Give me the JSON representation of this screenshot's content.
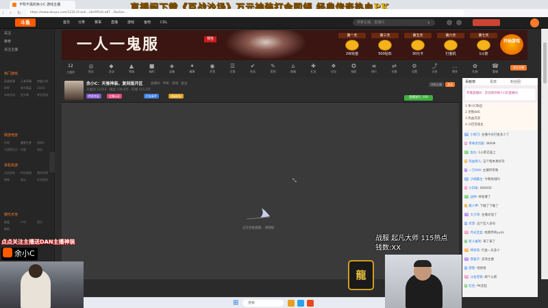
{
  "browser": {
    "tab_title": "不吹不黑的余小C 游戏主播",
    "url": "https://www.douyu.com/12313?rooh...e0c9f5d4-a87...3ba5ac...",
    "nav": "‹ › ↻"
  },
  "stream_banner_text": "直播间下载《百战沙场》万元神装打金即领  经典传奇热血PK",
  "header": {
    "logo": "斗鱼",
    "nav": [
      "首页",
      "分类",
      "赛事",
      "直播",
      "游戏",
      "鱼吧",
      "CDL"
    ],
    "search_placeholder": "搜索主播、直播间"
  },
  "sidebar": {
    "top_items": [
      "关注",
      "推荐",
      "关注主播"
    ],
    "sections": [
      {
        "title": "热门游戏",
        "items": [
          "英雄联盟",
          "王者荣耀",
          "穿越火线",
          "DNF",
          "和平精英",
          "CSGO",
          "永劫无间",
          "逆水寒",
          "梦幻西游"
        ]
      },
      {
        "title": "网游竞技",
        "items": [
          "传奇",
          "魔兽世界",
          "剑网3",
          "天涯明月刀",
          "问道",
          "诛仙"
        ]
      },
      {
        "title": "单机热游",
        "items": [
          "主机游戏",
          "怀旧游戏",
          "我的世界",
          "原神",
          "鬼泣",
          "生化危机"
        ]
      },
      {
        "title": "娱乐天地",
        "items": [
          "颜值",
          "户外",
          "音乐",
          "舞蹈"
        ]
      }
    ]
  },
  "ad": {
    "title": "一人一鬼服",
    "tag": "预告",
    "rewards": [
      {
        "day": "第一天",
        "label": "2W充值"
      },
      {
        "day": "第三天",
        "label": "500钻石"
      },
      {
        "day": "第五天",
        "label": "30元卡"
      },
      {
        "day": "第六天",
        "label": "打金机"
      },
      {
        "day": "第七天",
        "label": "1火箭"
      }
    ],
    "cta": "开始游戏"
  },
  "icon_row": {
    "count": "12",
    "count_label": "主播榜",
    "items": [
      "鱼丸",
      "活动",
      "等级",
      "福利",
      "宝箱",
      "徽章",
      "开黑",
      "日常",
      "任务",
      "签到",
      "商城",
      "礼包",
      "红包",
      "抽奖",
      "排行",
      "兑换",
      "设置",
      "分享",
      "更多",
      "礼物",
      "客服"
    ],
    "follow": "关注主播"
  },
  "streamer": {
    "title": "余小C：天蚕神装，复刻版开区",
    "subtitle": "直播间 · 传奇 · 游戏 · 复古",
    "meta": "斗鱼ID 12313 · 粉丝 236.9万 · 在线 115.2万",
    "chips": [
      "传奇专区",
      "主播认证",
      "打金高手",
      "超级粉丝"
    ],
    "report": "举报主播",
    "follow": "关注",
    "gift": "直播送礼 100"
  },
  "player": {
    "loading": "正在连接直播... 请稍候"
  },
  "chat": {
    "tabs": [
      "贡献榜",
      "贵宾",
      "粉丝团"
    ],
    "notice": "专属直播间 · 欢迎来到余小C的直播间",
    "rank": [
      "1 余小C粉丝",
      "2 老铁666",
      "3 热血兄弟",
      "4 沙巴克城主"
    ],
    "messages": [
      {
        "badge": "12",
        "name": "小刺刀",
        "text": "主播今天打金多少了"
      },
      {
        "badge": "8",
        "name": "传奇老玩家",
        "text": "冲冲冲"
      },
      {
        "badge": "15",
        "name": "鱼丸",
        "text": "1火箭已送上"
      },
      {
        "badge": "6",
        "name": "热血男儿",
        "text": "这个版本真好玩"
      },
      {
        "badge": "9",
        "name": "一刀999",
        "text": "主播带带我"
      },
      {
        "badge": "20",
        "name": "沙城霸主",
        "text": "今晚攻城吗"
      },
      {
        "badge": "4",
        "name": "小白兔",
        "text": "666666"
      },
      {
        "badge": "11",
        "name": "战神",
        "text": "神装爆了"
      },
      {
        "badge": "7",
        "name": "路人甲",
        "text": "下载了下载了"
      },
      {
        "badge": "13",
        "name": "大刀哥",
        "text": "主播太强了"
      },
      {
        "badge": "5",
        "name": "老李",
        "text": "这个区人多吗"
      },
      {
        "badge": "16",
        "name": "月光宝盒",
        "text": "经典传奇yyds"
      },
      {
        "badge": "3",
        "name": "新人报到",
        "text": "来了来了"
      },
      {
        "badge": "14",
        "name": "神装哥",
        "text": "打金一天多少"
      },
      {
        "badge": "10",
        "name": "夜猫子",
        "text": "支持主播"
      },
      {
        "badge": "2",
        "name": "游客",
        "text": "哈哈哈"
      },
      {
        "badge": "18",
        "name": "斗鱼老铁",
        "text": "刷个火箭"
      },
      {
        "badge": "8",
        "name": "红名",
        "text": "PK走起"
      }
    ]
  },
  "overlays": {
    "left_caption": "点点关注主播送DAN主播神装",
    "logo_text": "余小C",
    "right_line1": "战服  起凡大师 115热点",
    "right_line2": "钱数:XX",
    "game_icon_text": "龍"
  },
  "taskbar": {
    "search": "搜索"
  }
}
